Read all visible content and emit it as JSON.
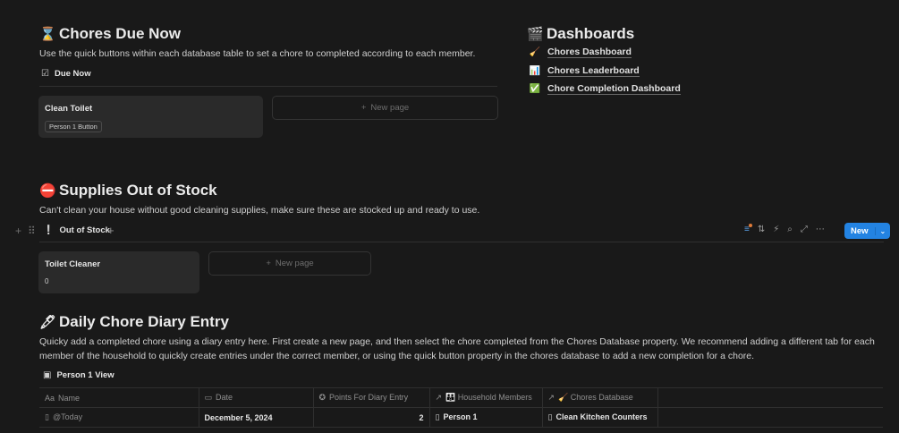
{
  "chores_due": {
    "emoji": "⌛",
    "title": "Chores Due Now",
    "description": "Use the quick buttons within each database table to set a chore to completed according to each member.",
    "view_icon": "☑",
    "view_label": "Due Now",
    "card_title": "Clean Toilet",
    "card_chip": "Person 1 Button",
    "new_page": "New page",
    "plus": "+"
  },
  "dashboards": {
    "emoji": "🎬",
    "title": "Dashboards",
    "links": [
      {
        "icon": "🧹",
        "label": "Chores Dashboard"
      },
      {
        "icon": "📊",
        "label": "Chores Leaderboard"
      },
      {
        "icon": "✅",
        "label": "Chore Completion Dashboard"
      }
    ]
  },
  "supplies": {
    "emoji": "⛔",
    "title": "Supplies Out of Stock",
    "description": "Can't clean your house without good cleaning supplies, make sure these are stocked up and ready to use.",
    "view_icon": "❕",
    "view_label": "Out of Stock",
    "card_title": "Toilet Cleaner",
    "card_value": "0",
    "new_page": "New page",
    "plus": "+",
    "add_view": "+",
    "block_add": "+",
    "block_drag": "⠿",
    "new_button": "New",
    "new_button_caret": "⌄",
    "toolbar_icons": [
      "filter-icon",
      "sort-icon",
      "automation-icon",
      "search-icon",
      "expand-icon",
      "more-icon"
    ],
    "toolbar_glyphs": [
      "≡",
      "⇅",
      "⚡",
      "⌕",
      "⤢",
      "⋯"
    ],
    "accent": "#2383e2",
    "filter_dot": "#e07b39"
  },
  "diary": {
    "emoji": "🖋",
    "title": "Daily Chore Diary Entry",
    "description": "Quicky add a completed chore using a diary entry here.  First create a new page, and then select the chore completed from the Chores Database property. We recommend adding a different tab for each member of the household to quickly create entries under the correct member, or using the quick button property in the chores database to add a new completion for a chore.",
    "view_icon": "▣",
    "view_label": "Person 1 View",
    "columns": [
      {
        "icon": "Aa",
        "label": "Name"
      },
      {
        "icon": "▭",
        "label": "Date"
      },
      {
        "icon": "✪",
        "label": "Points For Diary Entry"
      },
      {
        "icon": "↗",
        "label": "👪 Household Members"
      },
      {
        "icon": "↗",
        "label": "🧹 Chores Database"
      }
    ],
    "row": {
      "name": "@Today",
      "date": "December 5, 2024",
      "points": "2",
      "member": "Person 1",
      "chore": "Clean Kitchen Counters"
    }
  }
}
